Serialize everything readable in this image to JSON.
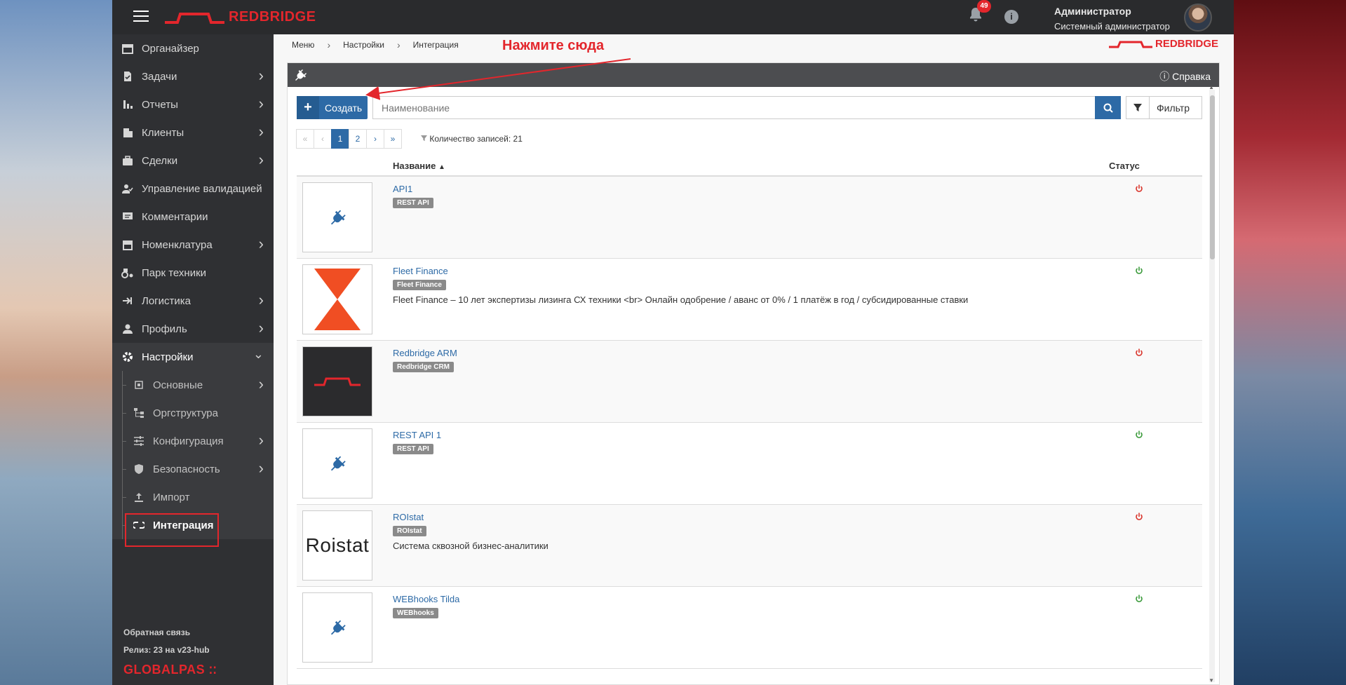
{
  "header": {
    "logo_text": "REDBRIDGE",
    "notifications_count": "49",
    "user_name": "Администратор",
    "user_role": "Системный администратор"
  },
  "sidebar": {
    "items": [
      {
        "label": "Органайзер",
        "icon": "calendar-icon",
        "has_children": false
      },
      {
        "label": "Задачи",
        "icon": "task-icon",
        "has_children": true
      },
      {
        "label": "Отчеты",
        "icon": "bar-chart-icon",
        "has_children": true
      },
      {
        "label": "Клиенты",
        "icon": "building-icon",
        "has_children": true
      },
      {
        "label": "Сделки",
        "icon": "briefcase-icon",
        "has_children": true
      },
      {
        "label": "Управление валидацией",
        "icon": "user-check-icon",
        "has_children": false
      },
      {
        "label": "Комментарии",
        "icon": "comment-icon",
        "has_children": false
      },
      {
        "label": "Номенклатура",
        "icon": "store-icon",
        "has_children": true
      },
      {
        "label": "Парк техники",
        "icon": "tractor-icon",
        "has_children": false
      },
      {
        "label": "Логистика",
        "icon": "logistics-icon",
        "has_children": true
      },
      {
        "label": "Профиль",
        "icon": "user-icon",
        "has_children": true
      },
      {
        "label": "Настройки",
        "icon": "gear-icon",
        "has_children": true
      }
    ],
    "sub_items": [
      {
        "label": "Основные",
        "icon": "chip-icon",
        "has_children": true
      },
      {
        "label": "Оргструктура",
        "icon": "org-icon",
        "has_children": false
      },
      {
        "label": "Конфигурация",
        "icon": "sliders-icon",
        "has_children": true
      },
      {
        "label": "Безопасность",
        "icon": "shield-icon",
        "has_children": true
      },
      {
        "label": "Импорт",
        "icon": "upload-icon",
        "has_children": false
      },
      {
        "label": "Интеграция",
        "icon": "integration-icon",
        "has_children": false
      }
    ],
    "footer": {
      "feedback": "Обратная связь",
      "release": "Релиз: 23 на v23-hub",
      "brand": "GLOBALPAS"
    }
  },
  "breadcrumb": [
    "Меню",
    "Настройки",
    "Интеграция"
  ],
  "callout": "Нажмите сюда",
  "panel": {
    "help_label": "Справка",
    "create_label": "Создать",
    "search_placeholder": "Наименование",
    "filter_label": "Фильтр",
    "pager": [
      "«",
      "‹",
      "1",
      "2",
      "›",
      "»"
    ],
    "current_page": "1",
    "record_count": "Количество записей: 21",
    "col_name": "Название",
    "col_status": "Статус"
  },
  "rows": [
    {
      "name": "API1",
      "tag": "REST API",
      "desc": "",
      "status": "off",
      "thumb": "plug"
    },
    {
      "name": "Fleet Finance",
      "tag": "Fleet Finance",
      "desc": "Fleet Finance – 10 лет экспертизы лизинга СХ техники <br> Онлайн одобрение / аванс от 0% / 1 платёж в год / субсидированные ставки",
      "status": "on",
      "thumb": "hourglass"
    },
    {
      "name": "Redbridge ARM",
      "tag": "Redbridge CRM",
      "desc": "",
      "status": "off",
      "thumb": "redbridge"
    },
    {
      "name": "REST API 1",
      "tag": "REST API",
      "desc": "",
      "status": "on",
      "thumb": "plug"
    },
    {
      "name": "ROIstat",
      "tag": "ROIstat",
      "desc": "Система сквозной бизнес-аналитики",
      "status": "off",
      "thumb": "roistat",
      "thumb_text": "Roistat"
    },
    {
      "name": "WEBhooks Tilda",
      "tag": "WEBhooks",
      "desc": "",
      "status": "on",
      "thumb": "plug"
    }
  ],
  "colors": {
    "accent": "#2d6aa6",
    "brand_red": "#e3262c",
    "status_on": "#3a9a3a",
    "status_off": "#d9342b"
  }
}
